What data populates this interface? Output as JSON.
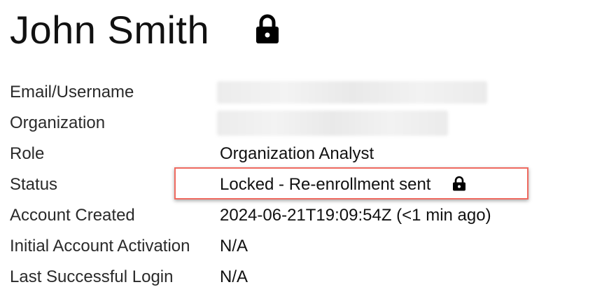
{
  "header": {
    "name": "John Smith",
    "lock_icon": "lock-icon"
  },
  "details": {
    "email_label": "Email/Username",
    "organization_label": "Organization",
    "role_label": "Role",
    "role_value": "Organization Analyst",
    "status_label": "Status",
    "status_value": "Locked - Re-enrollment sent",
    "status_icon": "lock-icon",
    "created_label": "Account Created",
    "created_value": "2024-06-21T19:09:54Z (<1 min ago)",
    "activation_label": "Initial Account Activation",
    "activation_value": "N/A",
    "last_login_label": "Last Successful Login",
    "last_login_value": "N/A"
  },
  "colors": {
    "highlight_border": "#ef6a60",
    "redaction": "#ececec"
  }
}
